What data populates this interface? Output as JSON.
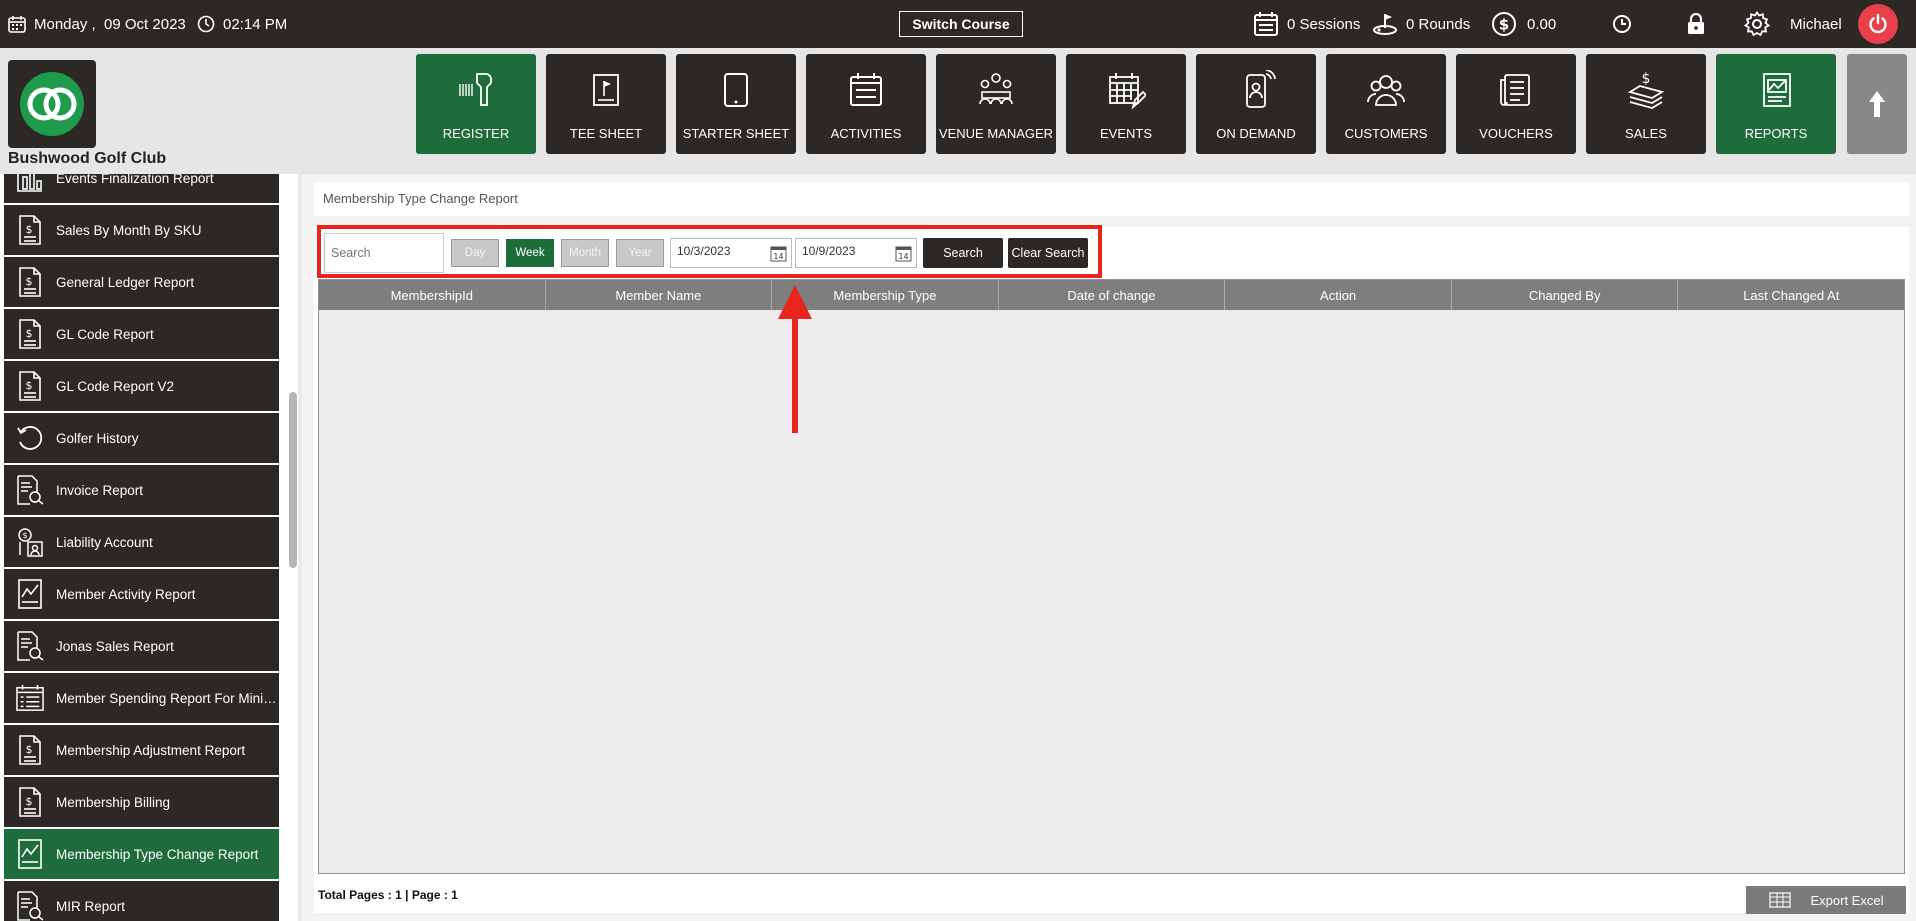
{
  "topbar": {
    "date": "Monday ,  09 Oct 2023",
    "time": "02:14 PM",
    "switch_course": "Switch Course",
    "sessions": "0 Sessions",
    "rounds": "0 Rounds",
    "balance": "0.00",
    "user": "Michael"
  },
  "club": {
    "name": "Bushwood Golf Club"
  },
  "nav": [
    {
      "label": "REGISTER",
      "icon": "barcode-scanner-icon",
      "active": true
    },
    {
      "label": "TEE SHEET",
      "icon": "tee-sheet-icon",
      "active": false
    },
    {
      "label": "STARTER SHEET",
      "icon": "tablet-icon",
      "active": false
    },
    {
      "label": "ACTIVITIES",
      "icon": "calendar-list-icon",
      "active": false
    },
    {
      "label": "VENUE MANAGER",
      "icon": "meeting-icon",
      "active": false
    },
    {
      "label": "EVENTS",
      "icon": "calendar-edit-icon",
      "active": false
    },
    {
      "label": "ON DEMAND",
      "icon": "mobile-person-icon",
      "active": false
    },
    {
      "label": "CUSTOMERS",
      "icon": "users-icon",
      "active": false
    },
    {
      "label": "VOUCHERS",
      "icon": "voucher-icon",
      "active": false
    },
    {
      "label": "SALES",
      "icon": "money-stack-icon",
      "active": false
    },
    {
      "label": "REPORTS",
      "icon": "report-chart-icon",
      "active": true
    }
  ],
  "sidebar": {
    "items": [
      {
        "label": "Events Finalization Report",
        "icon": "bar-chart-icon"
      },
      {
        "label": "Sales By Month By SKU",
        "icon": "dollar-doc-icon"
      },
      {
        "label": "General Ledger Report",
        "icon": "dollar-doc-icon"
      },
      {
        "label": "GL Code Report",
        "icon": "dollar-doc-icon"
      },
      {
        "label": "GL Code Report V2",
        "icon": "dollar-doc-icon"
      },
      {
        "label": "Golfer History",
        "icon": "history-icon"
      },
      {
        "label": "Invoice Report",
        "icon": "invoice-search-icon"
      },
      {
        "label": "Liability Account",
        "icon": "liability-icon"
      },
      {
        "label": "Member Activity Report",
        "icon": "activity-chart-icon"
      },
      {
        "label": "Jonas Sales Report",
        "icon": "invoice-search-icon"
      },
      {
        "label": "Member Spending Report For Minim...",
        "icon": "list-doc-icon"
      },
      {
        "label": "Membership Adjustment Report",
        "icon": "dollar-doc-icon"
      },
      {
        "label": "Membership Billing",
        "icon": "dollar-doc-icon"
      },
      {
        "label": "Membership Type Change Report",
        "icon": "activity-chart-icon",
        "active": true
      },
      {
        "label": "MIR Report",
        "icon": "invoice-search-icon"
      }
    ]
  },
  "report": {
    "title": "Membership Type Change Report",
    "search_placeholder": "Search",
    "periods": [
      "Day",
      "Week",
      "Month",
      "Year"
    ],
    "active_period": "Week",
    "from_date": "10/3/2023",
    "to_date": "10/9/2023",
    "search_label": "Search",
    "clear_label": "Clear Search",
    "columns": [
      "MembershipId",
      "Member Name",
      "Membership Type",
      "Date of change",
      "Action",
      "Changed By",
      "Last Changed At"
    ],
    "rows": [],
    "pager": "Total Pages : 1 | Page : 1",
    "export_label": "Export Excel"
  },
  "colors": {
    "dark": "#2b2826",
    "green": "#1e6b3c",
    "highlight_red": "#e8241f",
    "power_red": "#e7404a"
  }
}
